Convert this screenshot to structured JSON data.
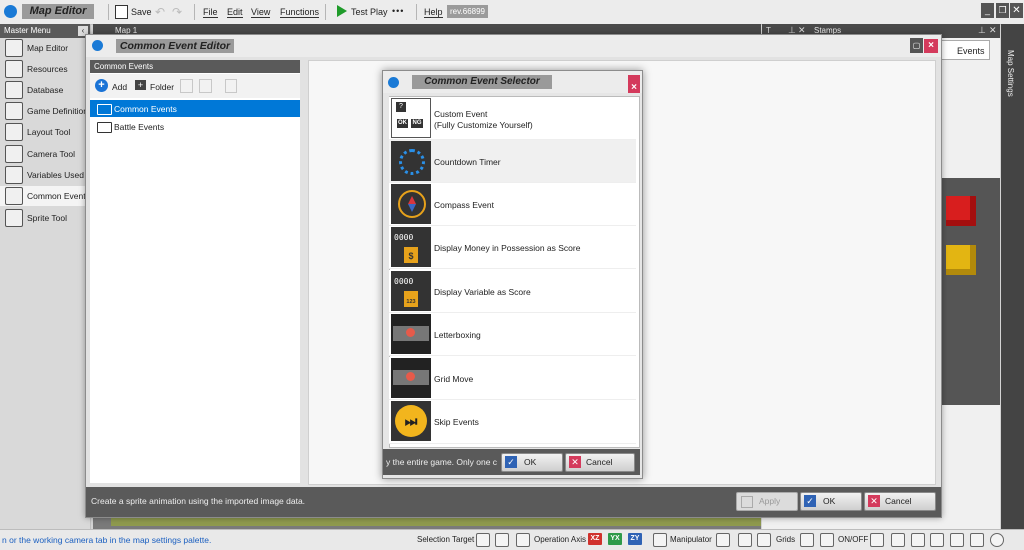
{
  "app": {
    "title": "Map Editor",
    "save": "Save",
    "file": "File",
    "edit": "Edit",
    "view": "View",
    "functions": "Functions",
    "test_play": "Test Play",
    "dots": "•••",
    "help": "Help",
    "rev": "rev.66899"
  },
  "master_menu": {
    "title": "Master Menu",
    "items": [
      {
        "label": "Map Editor",
        "icon": "map-icon"
      },
      {
        "label": "Resources",
        "icon": "resources-icon"
      },
      {
        "label": "Database",
        "icon": "database-icon"
      },
      {
        "label": "Game Definition",
        "icon": "gamepad-icon"
      },
      {
        "label": "Layout Tool",
        "icon": "layout-icon"
      },
      {
        "label": "Camera Tool",
        "icon": "camera-icon"
      },
      {
        "label": "Variables Used",
        "icon": "variables-icon"
      },
      {
        "label": "Common Events",
        "icon": "common-events-icon"
      },
      {
        "label": "Sprite Tool",
        "icon": "sprite-icon"
      }
    ]
  },
  "background": {
    "map_tab": "Map 1",
    "stamps_tab": "Stamps",
    "events_tab": "Events",
    "map_settings_vertical": "Map Settings"
  },
  "common_event_editor": {
    "title": "Common Event Editor",
    "panel_header": "Common Events",
    "add": "Add",
    "folder": "Folder",
    "tree": [
      {
        "label": "Common Events",
        "selected": true
      },
      {
        "label": "Battle Events",
        "selected": false
      }
    ],
    "hint": "Create a sprite animation using the imported image data.",
    "apply": "Apply",
    "ok": "OK",
    "cancel": "Cancel"
  },
  "selector": {
    "title": "Common Event Selector",
    "items": [
      {
        "label": "Custom Event",
        "sub": "(Fully Customize Yourself)",
        "icon": "custom-event-icon",
        "selected": false
      },
      {
        "label": "Countdown Timer",
        "sub": "",
        "icon": "timer-icon",
        "selected": true
      },
      {
        "label": "Compass Event",
        "sub": "",
        "icon": "compass-icon",
        "selected": false
      },
      {
        "label": "Display Money in Possession as Score",
        "sub": "",
        "icon": "money-score-icon",
        "selected": false
      },
      {
        "label": "Display Variable as Score",
        "sub": "",
        "icon": "variable-score-icon",
        "selected": false
      },
      {
        "label": "Letterboxing",
        "sub": "",
        "icon": "letterbox-icon",
        "selected": false
      },
      {
        "label": "Grid Move",
        "sub": "",
        "icon": "grid-move-icon",
        "selected": false
      },
      {
        "label": "Skip Events",
        "sub": "",
        "icon": "skip-icon",
        "selected": false
      }
    ],
    "footer_text": "y the entire game.  Only one c",
    "ok": "OK",
    "cancel": "Cancel",
    "counter_digits": "0000",
    "variable_num": "123"
  },
  "status_bar": {
    "message": "n or the working camera tab in the map settings palette.",
    "selection_target": "Selection Target",
    "operation_axis": "Operation Axis",
    "xz": "XZ",
    "yx": "YX",
    "zy": "ZY",
    "manipulator": "Manipulator",
    "grids": "Grids",
    "onoff": "ON/OFF"
  },
  "colors": {
    "accent_blue": "#1173d4",
    "selection": "#0078d7",
    "close_red": "#d43a5c",
    "tag_red": "#d0312d",
    "tag_green": "#2e9a4a",
    "tag_blue": "#2f63b5"
  }
}
